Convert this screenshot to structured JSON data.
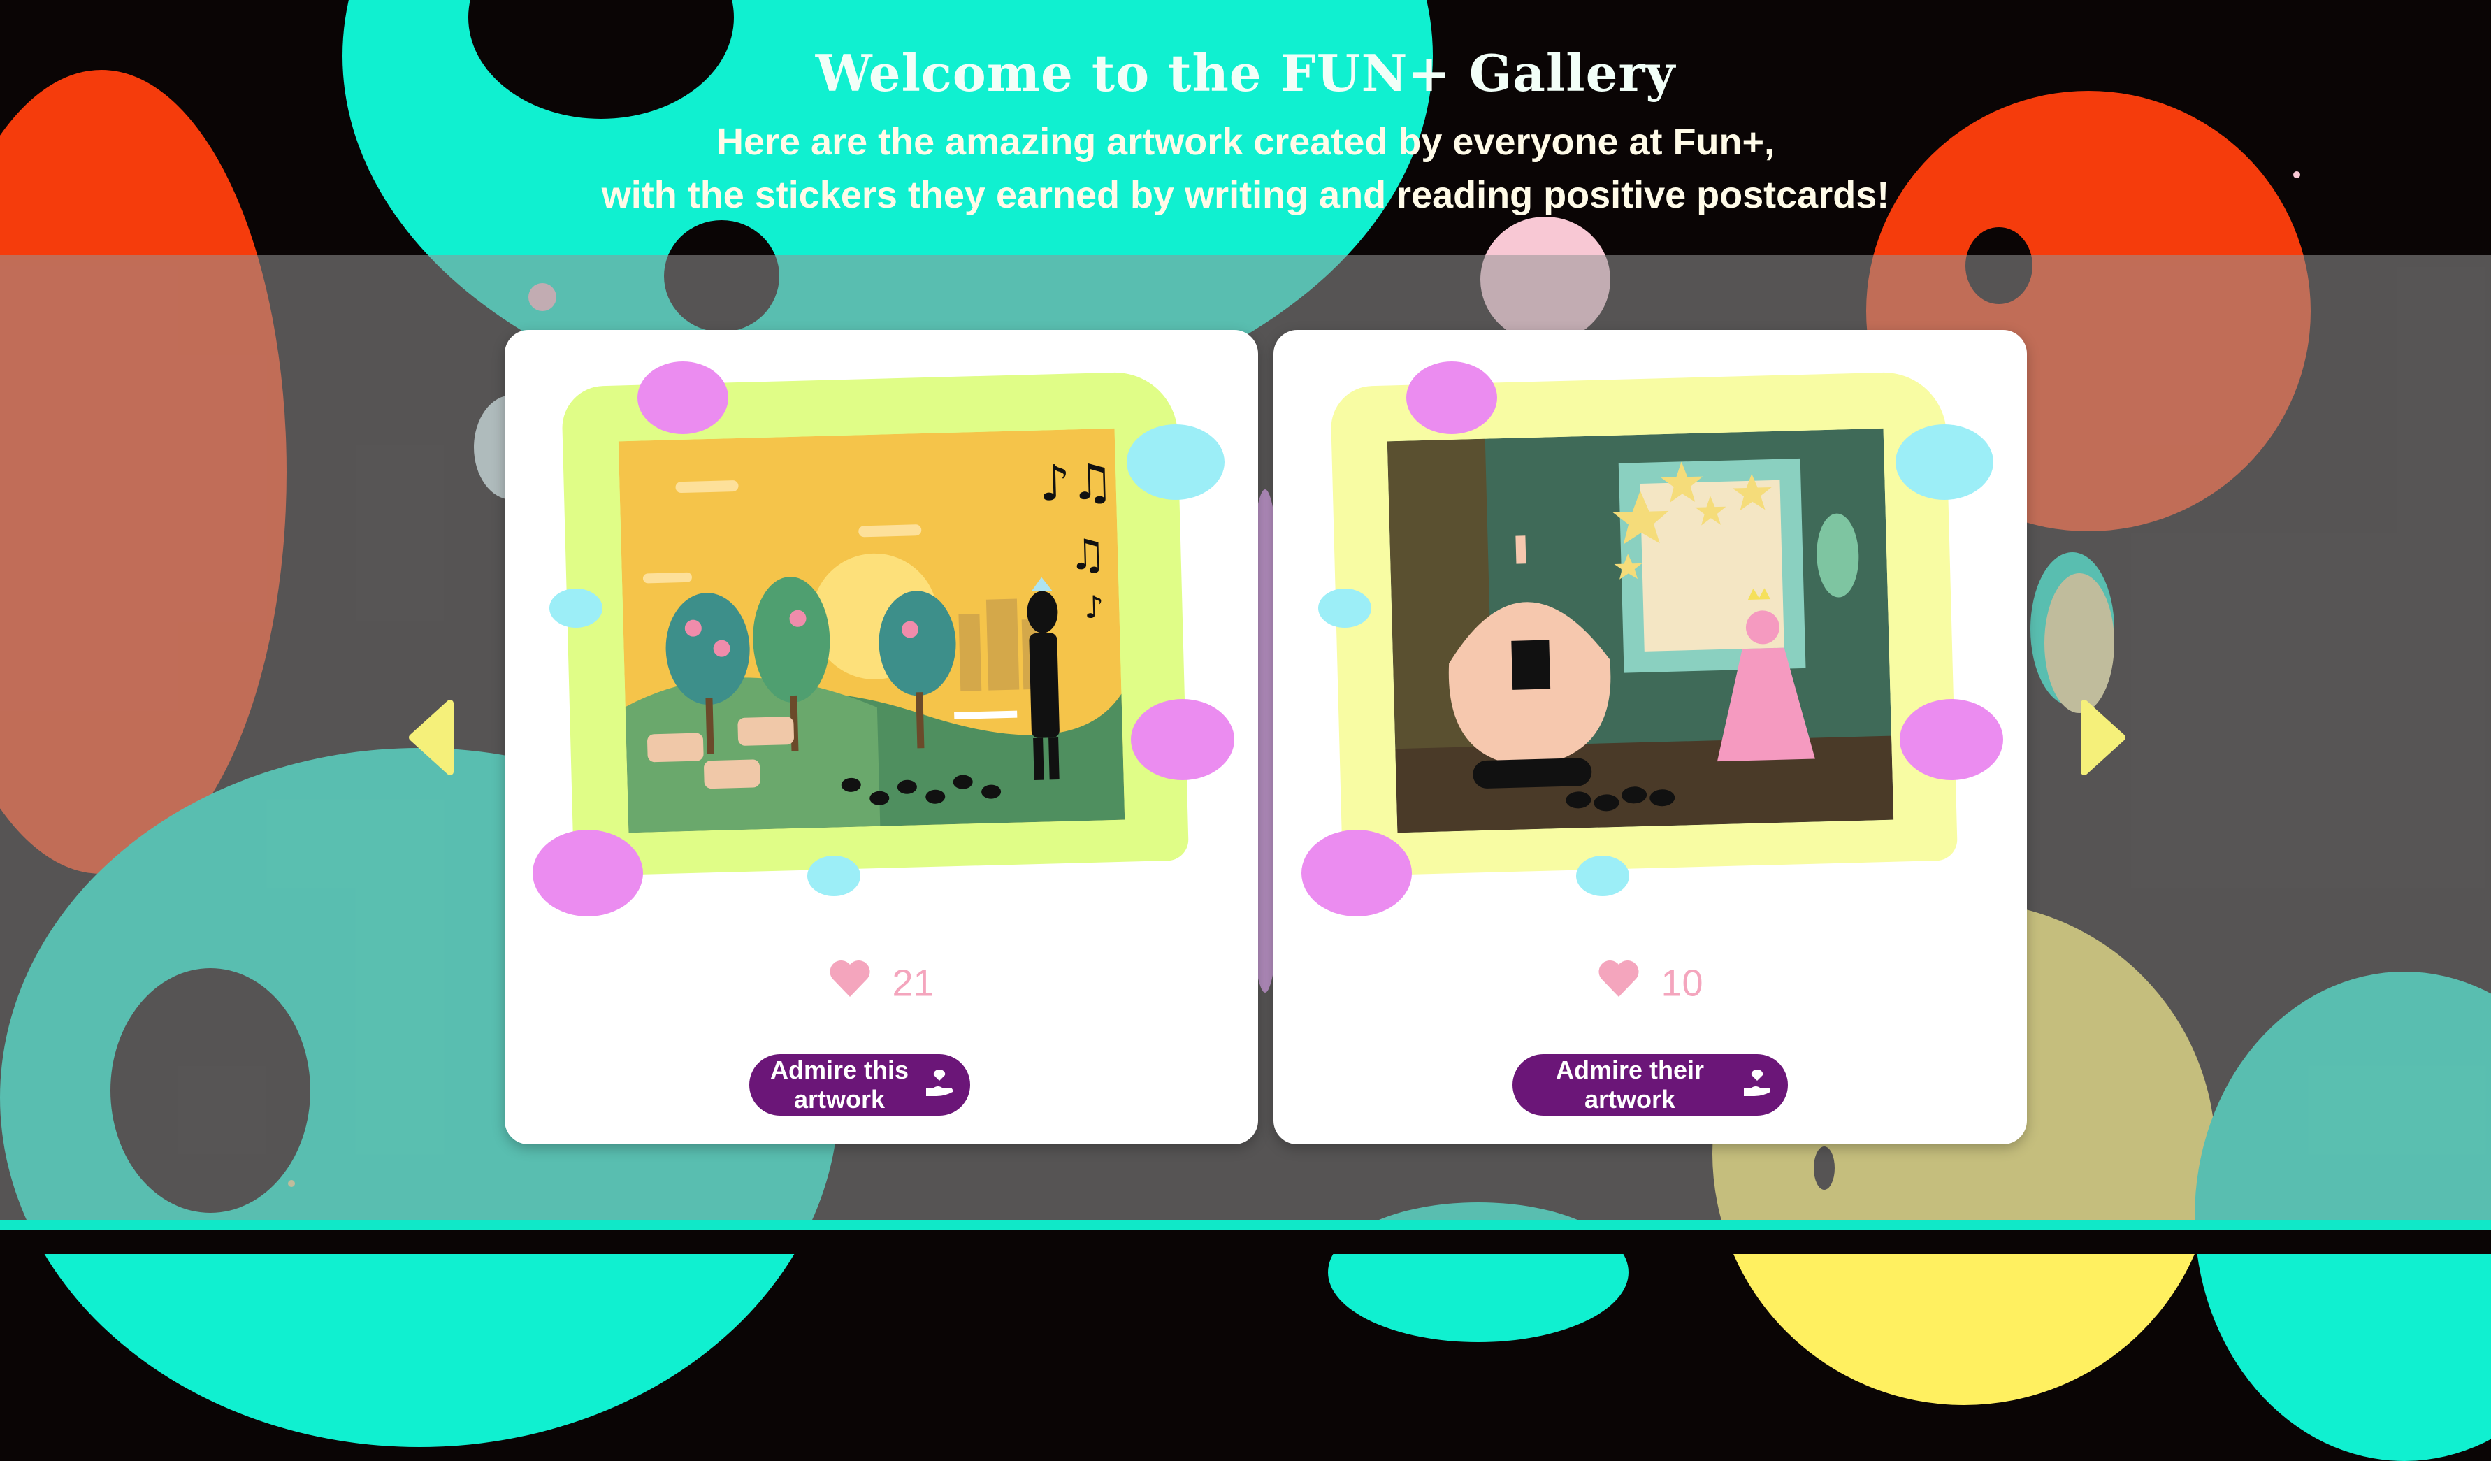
{
  "header": {
    "title": "Welcome to the FUN+ Gallery",
    "subtitle_line1": "Here are the amazing artwork created by everyone at Fun+,",
    "subtitle_line2": "with the stickers they earned by writing and reading positive postcards!"
  },
  "gallery": {
    "cards": [
      {
        "likes": "21",
        "button_label": "Admire this artwork"
      },
      {
        "likes": "10",
        "button_label": "Admire their artwork"
      }
    ]
  },
  "icons": {
    "prev": "chevron-left-icon",
    "next": "chevron-right-icon",
    "heart": "heart-icon",
    "admire": "hand-heart-icon"
  },
  "colors": {
    "background": "#0a0505",
    "cyan": "#10e8c8",
    "orange": "#f53c0c",
    "button": "#6b1678",
    "heart": "#f4a5bd",
    "arrow": "#f5f07a"
  }
}
